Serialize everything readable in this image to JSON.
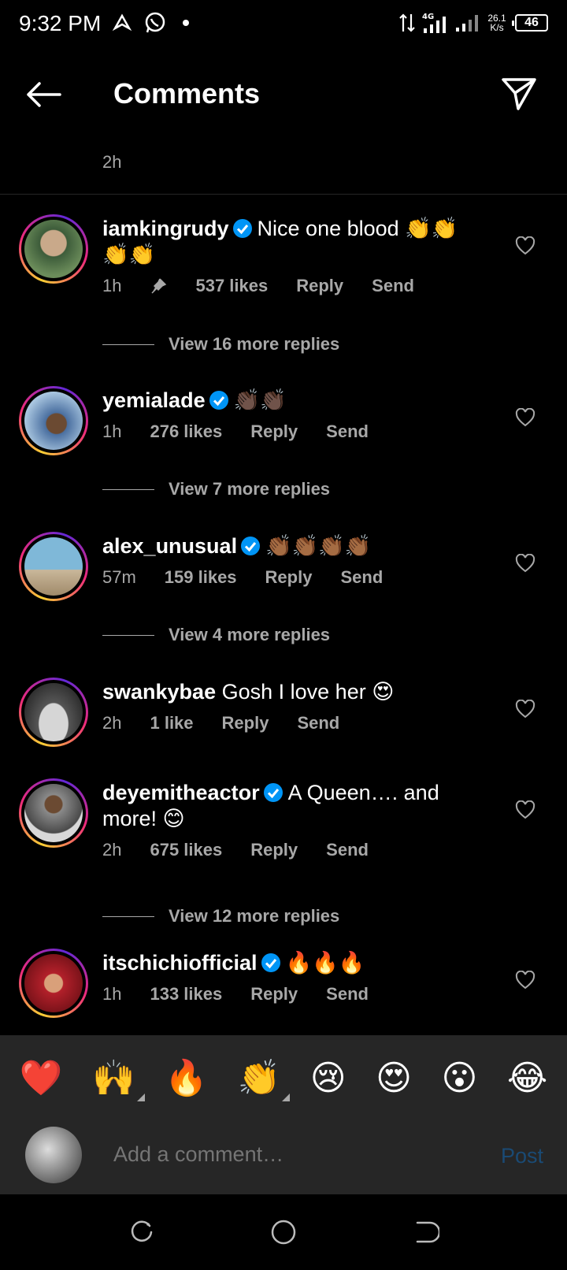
{
  "status_bar": {
    "time": "9:32 PM",
    "network": "4G",
    "speed_value": "26.1",
    "speed_unit": "K/s",
    "battery": "46"
  },
  "header": {
    "title": "Comments"
  },
  "previous_comment_time": "2h",
  "comments": [
    {
      "username": "iamkingrudy",
      "verified": true,
      "text": "Nice one blood 👏👏👏👏",
      "time": "1h",
      "pinned": true,
      "likes": "537 likes",
      "reply": "Reply",
      "send": "Send",
      "view_replies": "View 16 more replies",
      "avatar_color": "#3d5c3a"
    },
    {
      "username": "yemialade",
      "verified": true,
      "text": "👏🏿👏🏿",
      "time": "1h",
      "likes": "276 likes",
      "reply": "Reply",
      "send": "Send",
      "view_replies": "View 7 more replies",
      "avatar_color": "#4a6fa0"
    },
    {
      "username": "alex_unusual",
      "verified": true,
      "text": "👏🏾👏🏾👏🏾👏🏾",
      "time": "57m",
      "likes": "159 likes",
      "reply": "Reply",
      "send": "Send",
      "view_replies": "View 4 more replies",
      "avatar_color": "#7fb8d8"
    },
    {
      "username": "swankybae",
      "verified": false,
      "text": "Gosh I love her 😍",
      "time": "2h",
      "likes": "1 like",
      "reply": "Reply",
      "send": "Send",
      "avatar_color": "#555555"
    },
    {
      "username": "deyemitheactor",
      "verified": true,
      "text": "A Queen…. and more! 😊",
      "time": "2h",
      "likes": "675 likes",
      "reply": "Reply",
      "send": "Send",
      "view_replies": "View 12 more replies",
      "avatar_color": "#8a8a8a"
    },
    {
      "username": "itschichiofficial",
      "verified": true,
      "text": "🔥🔥🔥",
      "time": "1h",
      "likes": "133 likes",
      "reply": "Reply",
      "send": "Send",
      "avatar_color": "#b3202a"
    }
  ],
  "emoji_bar": [
    "❤️",
    "🙌",
    "🔥",
    "👏",
    "😢",
    "😍",
    "😮",
    "😂"
  ],
  "composer": {
    "placeholder": "Add a comment…",
    "post_label": "Post"
  },
  "colors": {
    "background": "#000000",
    "secondary_text": "#a8a8a8",
    "verified_blue": "#0095f6",
    "post_disabled": "#1a4a74"
  }
}
